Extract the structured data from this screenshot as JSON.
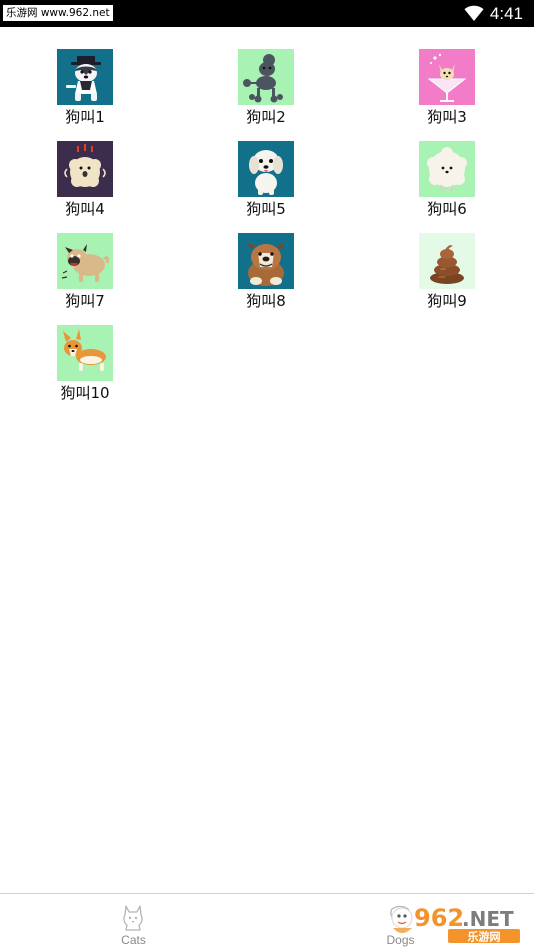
{
  "status_bar": {
    "watermark": "乐游网 www.962.net",
    "time": "4:41",
    "wifi_icon": "wifi-icon"
  },
  "grid": {
    "items": [
      {
        "label": "狗叫1",
        "icon": "husky-dog-icon",
        "bg": "#13708a"
      },
      {
        "label": "狗叫2",
        "icon": "poodle-dog-icon",
        "bg": "#a8f2b4"
      },
      {
        "label": "狗叫3",
        "icon": "chihuahua-cocktail-icon",
        "bg": "#f27cc8"
      },
      {
        "label": "狗叫4",
        "icon": "fluffy-dog-icon",
        "bg": "#3d2d4d"
      },
      {
        "label": "狗叫5",
        "icon": "maltese-dog-icon",
        "bg": "#13708a"
      },
      {
        "label": "狗叫6",
        "icon": "samoyed-dog-icon",
        "bg": "#a8f2b4"
      },
      {
        "label": "狗叫7",
        "icon": "pug-dog-icon",
        "bg": "#a8f2b4"
      },
      {
        "label": "狗叫8",
        "icon": "bulldog-icon",
        "bg": "#13708a"
      },
      {
        "label": "狗叫9",
        "icon": "dog-poop-icon",
        "bg": "#e2fae6"
      },
      {
        "label": "狗叫10",
        "icon": "corgi-dog-icon",
        "bg": "#a8f2b4"
      }
    ]
  },
  "bottom_nav": {
    "tabs": [
      {
        "label": "Cats",
        "icon": "cat-icon"
      },
      {
        "label": "Dogs",
        "icon": "dog-icon"
      }
    ]
  },
  "brand": {
    "logo_text": "962.NET",
    "logo_sub": "乐游网"
  }
}
